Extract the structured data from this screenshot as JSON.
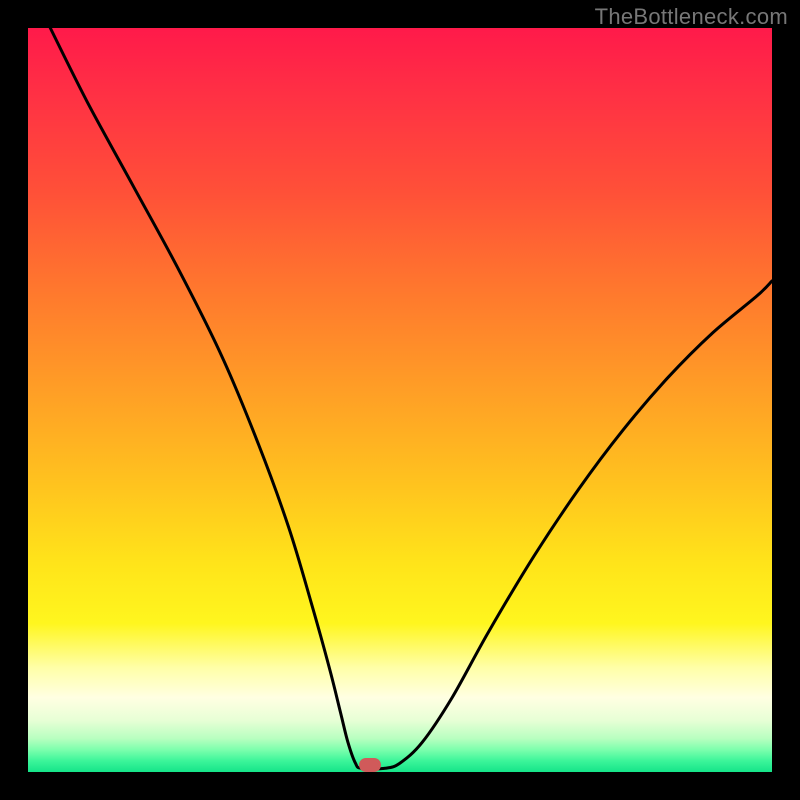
{
  "watermark": "TheBottleneck.com",
  "chart_data": {
    "type": "line",
    "title": "",
    "xlabel": "",
    "ylabel": "",
    "xlim": [
      0,
      100
    ],
    "ylim": [
      0,
      100
    ],
    "grid": false,
    "legend": false,
    "series": [
      {
        "name": "bottleneck-curve",
        "x": [
          3,
          8,
          14,
          20,
          26,
          31,
          35,
          38,
          40.5,
          42,
          43,
          44,
          44.8,
          48,
          50,
          53,
          57,
          62,
          68,
          74,
          80,
          86,
          92,
          98,
          100
        ],
        "y": [
          100,
          90,
          79,
          68,
          56,
          44,
          33,
          23,
          14,
          8,
          4,
          1.2,
          0.5,
          0.5,
          1.2,
          4,
          10,
          19,
          29,
          38,
          46,
          53,
          59,
          64,
          66
        ]
      }
    ],
    "marker": {
      "name": "optimal-point",
      "x": 46,
      "y": 0.9,
      "color": "#d05a5a"
    },
    "curve_color": "#000000",
    "curve_width": 3
  }
}
